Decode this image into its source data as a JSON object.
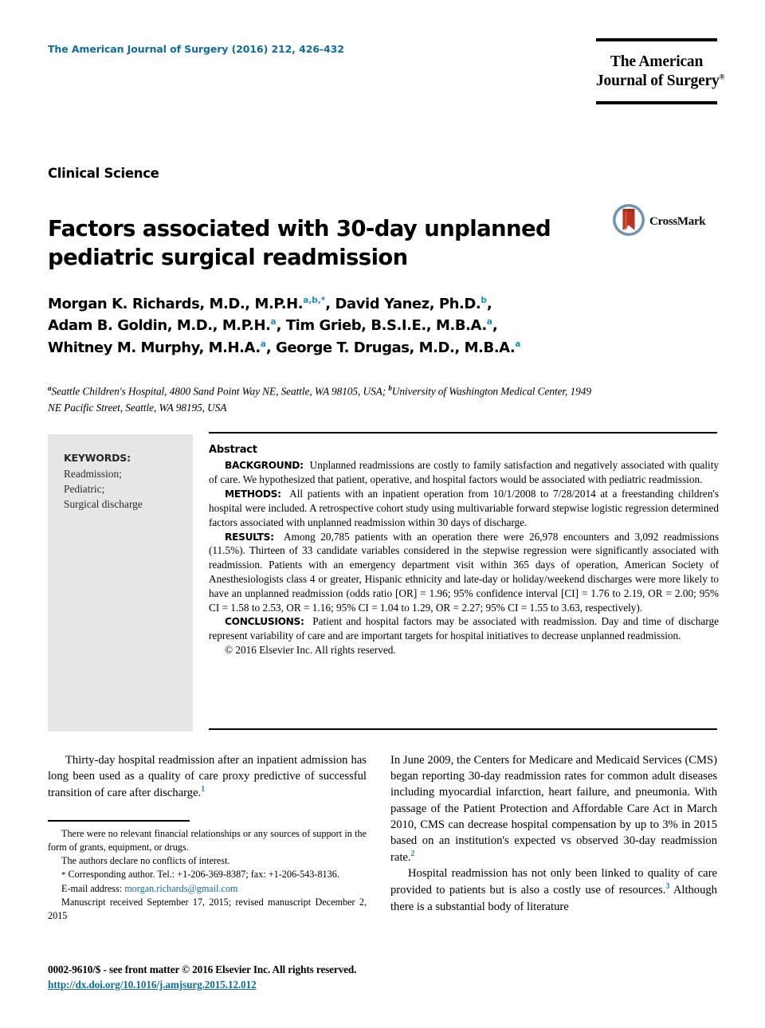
{
  "masthead": {
    "journal_reference": "The American Journal of Surgery (2016) 212, 426-432",
    "logo_line1": "The American",
    "logo_line2": "Journal of Surgery",
    "logo_trademark": "®",
    "accent_color": "#0f6d9e"
  },
  "header": {
    "section_label": "Clinical Science",
    "title": "Factors associated with 30-day unplanned pediatric surgical readmission",
    "crossmark_label": "CrossMark",
    "crossmark_ring_color": "#5b86a8",
    "crossmark_ribbon_color": "#c0392b"
  },
  "authors": {
    "line1_name1": "Morgan K. Richards, M.D., M.P.H.",
    "line1_sup1": "a,b,",
    "line1_star": "*",
    "line1_sep1": ", ",
    "line1_name2": "David Yanez, Ph.D.",
    "line1_sup2": "b",
    "line1_sep2": ",",
    "line2_name1": "Adam B. Goldin, M.D., M.P.H.",
    "line2_sup1": "a",
    "line2_sep1": ", ",
    "line2_name2": "Tim Grieb, B.S.I.E., M.B.A.",
    "line2_sup2": "a",
    "line2_sep2": ",",
    "line3_name1": "Whitney M. Murphy, M.H.A.",
    "line3_sup1": "a",
    "line3_sep1": ", ",
    "line3_name2": "George T. Drugas, M.D., M.B.A.",
    "line3_sup2": "a",
    "superscript_color": "#1a8cbd"
  },
  "affiliations": {
    "marker_a": "a",
    "text_a": "Seattle Children's Hospital, 4800 Sand Point Way NE, Seattle, WA 98105, USA; ",
    "marker_b": "b",
    "text_b": "University of Washington Medical Center, 1949 NE Pacific Street, Seattle, WA 98195, USA"
  },
  "keywords": {
    "title": "KEYWORDS:",
    "items": [
      "Readmission;",
      "Pediatric;",
      "Surgical discharge"
    ],
    "background_color": "#e6e6e6"
  },
  "abstract": {
    "heading": "Abstract",
    "background_label": "BACKGROUND:",
    "background_text": "Unplanned readmissions are costly to family satisfaction and negatively associated with quality of care. We hypothesized that patient, operative, and hospital factors would be associated with pediatric readmission.",
    "methods_label": "METHODS:",
    "methods_text": "All patients with an inpatient operation from 10/1/2008 to 7/28/2014 at a freestanding children's hospital were included. A retrospective cohort study using multivariable forward stepwise logistic regression determined factors associated with unplanned readmission within 30 days of discharge.",
    "results_label": "RESULTS:",
    "results_text": "Among 20,785 patients with an operation there were 26,978 encounters and 3,092 readmissions (11.5%). Thirteen of 33 candidate variables considered in the stepwise regression were significantly associated with readmission. Patients with an emergency department visit within 365 days of operation, American Society of Anesthesiologists class 4 or greater, Hispanic ethnicity and late-day or holiday/weekend discharges were more likely to have an unplanned readmission (odds ratio [OR] = 1.96; 95% confidence interval [CI] = 1.76 to 2.19, OR = 2.00; 95% CI = 1.58 to 2.53, OR = 1.16; 95% CI = 1.04 to 1.29, OR = 2.27; 95% CI = 1.55 to 3.63, respectively).",
    "conclusions_label": "CONCLUSIONS:",
    "conclusions_text": "Patient and hospital factors may be associated with readmission. Day and time of discharge represent variability of care and are important targets for hospital initiatives to decrease unplanned readmission.",
    "copyright": "© 2016 Elsevier Inc. All rights reserved."
  },
  "body": {
    "left_para1_pre": "Thirty-day hospital readmission after an inpatient admission has long been used as a quality of care proxy predictive of successful transition of care after discharge.",
    "left_para1_ref": "1",
    "right_para1": "In June 2009, the Centers for Medicare and Medicaid Services (CMS) began reporting 30-day readmission rates for common adult diseases including myocardial infarction, heart failure, and pneumonia. With passage of the Patient Protection and Affordable Care Act in March 2010, CMS can decrease hospital compensation by up to 3% in 2015 based on an institution's expected vs observed 30-day readmission rate.",
    "right_para1_ref": "2",
    "right_para2_pre": "Hospital readmission has not only been linked to quality of care provided to patients but is also a costly use of resources.",
    "right_para2_ref": "3",
    "right_para2_post": " Although there is a substantial body of literature"
  },
  "footnotes": {
    "funding": "There were no relevant financial relationships or any sources of support in the form of grants, equipment, or drugs.",
    "conflicts": "The authors declare no conflicts of interest.",
    "corresponding_star": "*",
    "corresponding": " Corresponding author. Tel.: +1-206-369-8387; fax: +1-206-543-8136.",
    "email_label": "E-mail address: ",
    "email": "morgan.richards@gmail.com",
    "manuscript": "Manuscript received September 17, 2015; revised manuscript December 2, 2015"
  },
  "footer": {
    "issn_line": "0002-9610/$ - see front matter © 2016 Elsevier Inc. All rights reserved.",
    "doi": "http://dx.doi.org/10.1016/j.amjsurg.2015.12.012",
    "link_color": "#0f6d9e"
  }
}
